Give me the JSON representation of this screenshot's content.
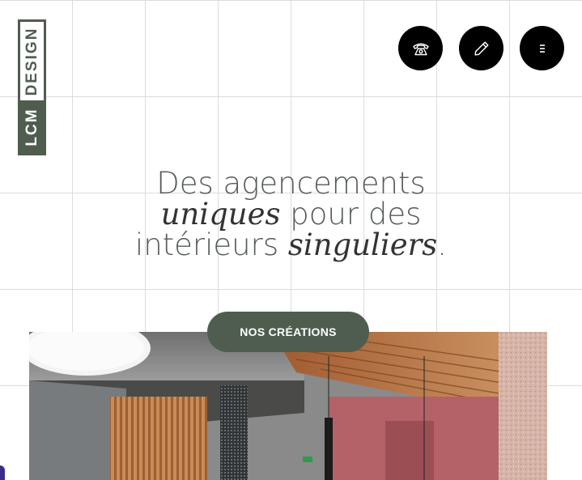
{
  "logo": {
    "top_text": "DESIGN",
    "bottom_text": "LCM"
  },
  "header_buttons": [
    {
      "icon": "phone-icon"
    },
    {
      "icon": "pencil-icon"
    },
    {
      "icon": "menu-icon"
    }
  ],
  "hero": {
    "line1": "Des agencements",
    "line2_em": "uniques",
    "line2_rest": " pour des",
    "line3_start": "intérieurs ",
    "line3_em": "singuliers",
    "line3_end": ".",
    "cta_label": "NOS CRÉATIONS"
  },
  "colors": {
    "brand_green": "#4f5d4f",
    "button_bg": "#000000",
    "accent": "#3b2a8f"
  }
}
